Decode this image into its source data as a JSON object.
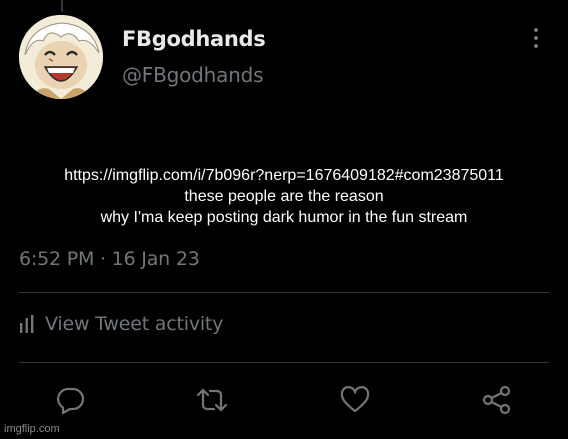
{
  "account": {
    "display_name": "FBgodhands",
    "handle": "@FBgodhands"
  },
  "menu": {
    "icon": "more-vertical-icon"
  },
  "tweet": {
    "lines": [
      "https://imgflip.com/i/7b096r?nerp=1676409182#com23875011",
      "these people are the reason",
      "why I'ma keep posting dark humor in the fun stream"
    ],
    "timestamp": "6:52 PM · 16 Jan 23"
  },
  "activity": {
    "label": "View Tweet activity",
    "icon": "bar-chart-icon"
  },
  "actions": {
    "reply_icon": "reply-icon",
    "retweet_icon": "retweet-icon",
    "like_icon": "heart-icon",
    "share_icon": "share-icon"
  },
  "watermark": "imgflip.com",
  "colors": {
    "background": "#000000",
    "primary_text": "#e7e9ea",
    "secondary_text": "#71767b",
    "divider": "#2f3336"
  }
}
